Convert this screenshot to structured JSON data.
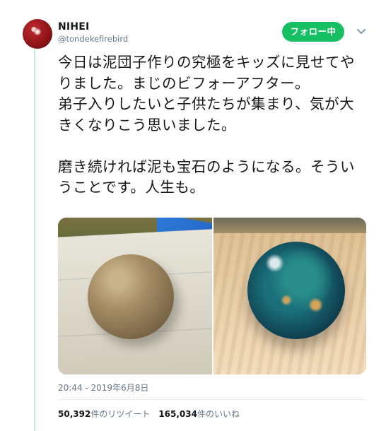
{
  "author": {
    "name": "NIHEI",
    "handle": "@tondekefirebird"
  },
  "follow_button_label": "フォロー中",
  "tweet_text": "今日は泥団子作りの究極をキッズに見せてやりました。まじのビフォーアフター。\n弟子入りしたいと子供たちが集まり、気が大きくなりこう思いました。\n\n磨き続ければ泥も宝石のようになる。そういうことです。人生も。",
  "media": {
    "left_photo": "mud-ball-before-photo",
    "right_photo": "polished-gem-ball-after-photo"
  },
  "timestamp": "20:44 - 2019年6月8日",
  "stats": {
    "retweets_count": "50,392",
    "retweets_label": "件のリツイート",
    "likes_count": "165,034",
    "likes_label": "件のいいね"
  },
  "colors": {
    "follow_button": "#17bf63",
    "thread_line": "#cfe6d9",
    "muted_text": "#657786"
  }
}
